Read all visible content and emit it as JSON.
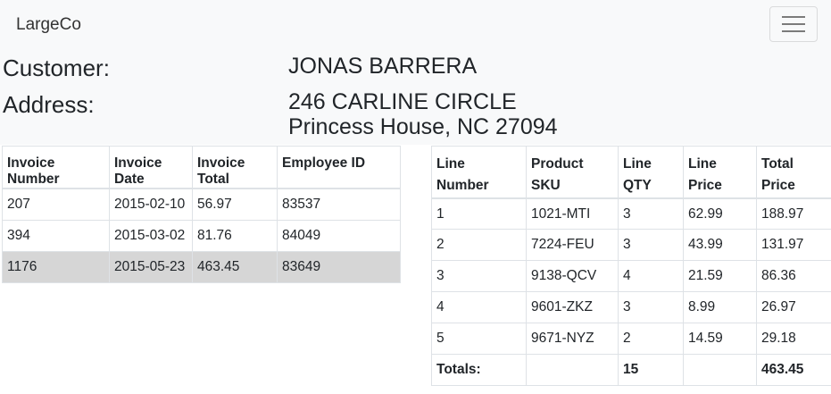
{
  "navbar": {
    "brand": "LargeCo",
    "toggler_icon": "hamburger-icon"
  },
  "customer": {
    "customer_label": "Customer:",
    "customer_name": "JONAS BARRERA",
    "address_label": "Address:",
    "address_line1": "246 CARLINE CIRCLE",
    "address_line2": "Princess House, NC 27094"
  },
  "invoices": {
    "headers": [
      "Invoice Number",
      "Invoice Date",
      "Invoice Total",
      "Employee ID"
    ],
    "rows": [
      [
        "207",
        "2015-02-10",
        "56.97",
        "83537"
      ],
      [
        "394",
        "2015-03-02",
        "81.76",
        "84049"
      ],
      [
        "1176",
        "2015-05-23",
        "463.45",
        "83649"
      ]
    ],
    "selected_row": 2
  },
  "lines": {
    "headers": [
      [
        "Line",
        "Number"
      ],
      [
        "Product",
        "SKU"
      ],
      [
        "Line",
        "QTY"
      ],
      [
        "Line",
        "Price"
      ],
      [
        "Total",
        "Price"
      ]
    ],
    "rows": [
      [
        "1",
        "1021-MTI",
        "3",
        "62.99",
        "188.97"
      ],
      [
        "2",
        "7224-FEU",
        "3",
        "43.99",
        "131.97"
      ],
      [
        "3",
        "9138-QCV",
        "4",
        "21.59",
        "86.36"
      ],
      [
        "4",
        "9601-ZKZ",
        "3",
        "8.99",
        "26.97"
      ],
      [
        "5",
        "9671-NYZ",
        "2",
        "14.59",
        "29.18"
      ]
    ],
    "totals": [
      "Totals:",
      "",
      "15",
      "",
      "463.45"
    ]
  },
  "colors": {
    "navbar_bg": "#f8f9fa",
    "selected_row_bg": "#d6d6d6",
    "border": "#dee2e6"
  }
}
